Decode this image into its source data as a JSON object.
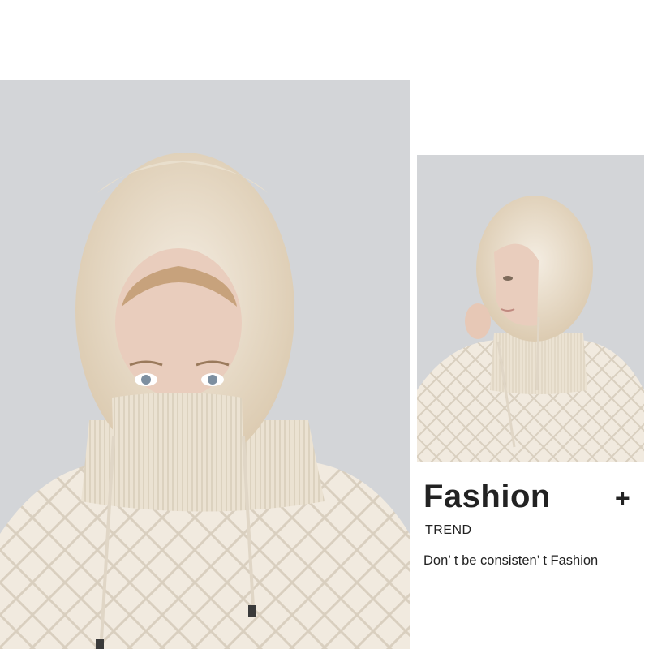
{
  "promo": {
    "headline": "Fashion",
    "plus_symbol": "+",
    "subheading": "TREND",
    "tagline": "Don’ t be consisten’ t Fashion"
  },
  "images": {
    "main": {
      "subject": "model wearing cream knit balaclava hat with fleece trim and cable-knit sweater, front view"
    },
    "side": {
      "subject": "model wearing cream knit balaclava hat, side view, hand at chin"
    }
  },
  "colors": {
    "background": "#ffffff",
    "photo_backdrop": "#d3d5d8",
    "knit_cream": "#efe7d9",
    "fleece": "#e6d8c2",
    "text": "#222222"
  }
}
